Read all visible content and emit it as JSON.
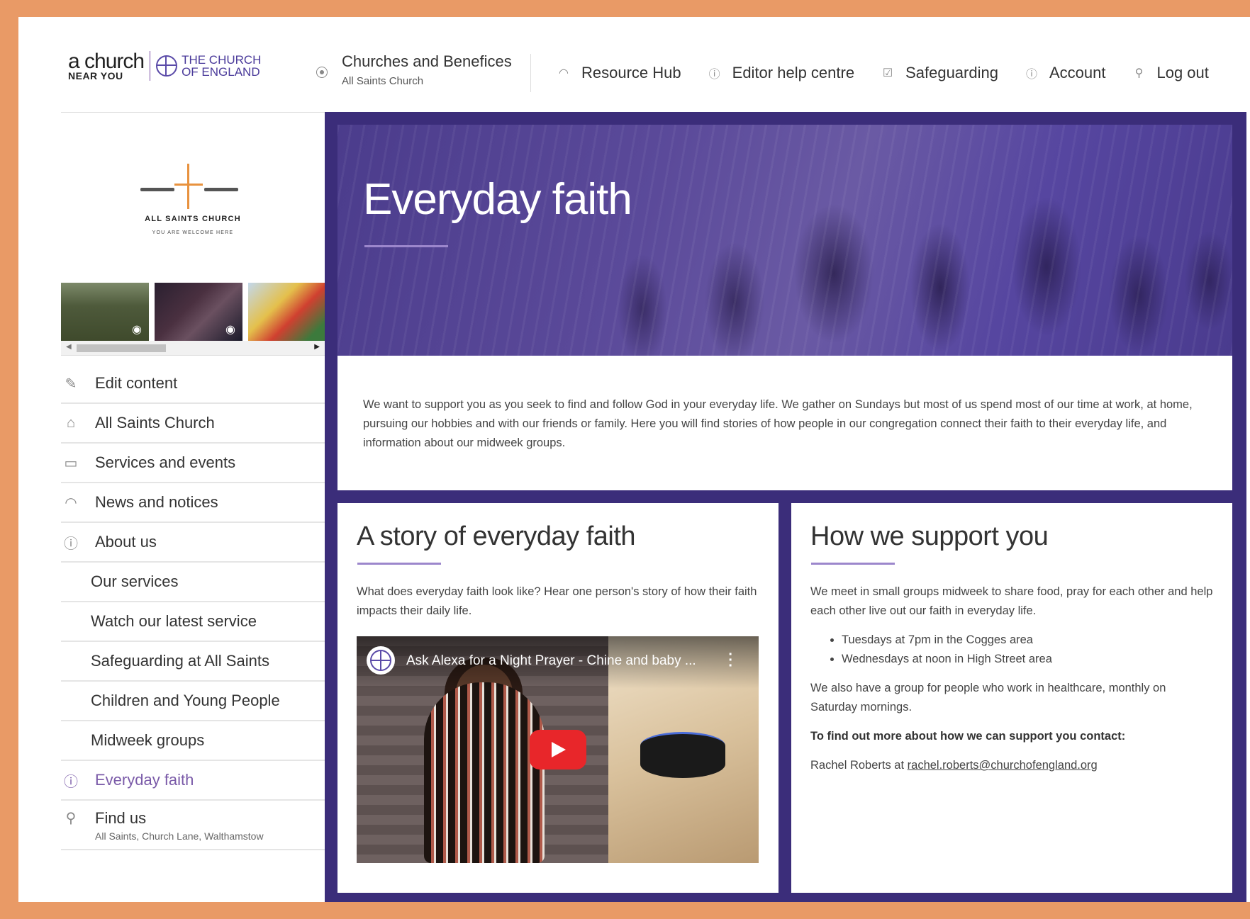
{
  "header": {
    "logo": {
      "a_church": "a church",
      "near_you": "NEAR YOU",
      "coe_line1": "THE CHURCH",
      "coe_line2": "OF ENGLAND"
    },
    "churches": {
      "title": "Churches and Benefices",
      "subtitle": "All Saints Church"
    },
    "nav": [
      {
        "label": "Resource Hub",
        "icon": "broadcast-icon"
      },
      {
        "label": "Editor help centre",
        "icon": "help-icon"
      },
      {
        "label": "Safeguarding",
        "icon": "checkbox-icon"
      },
      {
        "label": "Account",
        "icon": "info-icon"
      },
      {
        "label": "Log out",
        "icon": "key-icon"
      }
    ]
  },
  "sidebar": {
    "church_logo": {
      "name": "ALL SAINTS CHURCH",
      "tagline": "YOU ARE WELCOME HERE"
    },
    "menu": [
      {
        "label": "Edit content",
        "icon": "pencil-icon"
      },
      {
        "label": "All Saints Church",
        "icon": "home-icon"
      },
      {
        "label": "Services and events",
        "icon": "calendar-icon"
      },
      {
        "label": "News and notices",
        "icon": "broadcast-icon"
      },
      {
        "label": "About us",
        "icon": "info-icon"
      }
    ],
    "submenu": [
      {
        "label": "Our services"
      },
      {
        "label": "Watch our latest service"
      },
      {
        "label": "Safeguarding at All Saints"
      },
      {
        "label": "Children and Young People"
      },
      {
        "label": "Midweek groups"
      }
    ],
    "active": {
      "label": "Everyday faith",
      "icon": "info-icon"
    },
    "find_us": {
      "label": "Find us",
      "address": "All Saints, Church Lane, Walthamstow",
      "icon": "map-pin-icon"
    }
  },
  "main": {
    "hero_title": "Everyday faith",
    "intro": "We want to support you as you seek to find and follow God in your everyday life. We gather on Sundays but most of us spend most of our time at work, at home, pursuing our hobbies and with our friends or family. Here you will find stories of how people in our congregation connect their faith to their everyday life, and information about our midweek groups.",
    "story": {
      "title": "A story of everyday faith",
      "text": "What does everyday faith look like? Hear one person's story of how their faith impacts their daily life.",
      "video_title": "Ask Alexa for a Night Prayer - Chine and baby ..."
    },
    "support": {
      "title": "How we support you",
      "text": "We meet in small groups midweek to share food, pray for each other and help each other live out our faith in everyday life.",
      "bullets": [
        "Tuesdays at 7pm in the Cogges area",
        "Wednesdays at noon in High Street area"
      ],
      "healthcare": "We also have a group for people who work in healthcare, monthly on Saturday mornings.",
      "contact_heading": "To find out more about how we can support you contact:",
      "contact_prefix": "Rachel Roberts at ",
      "contact_email": "rachel.roberts@churchofengland.org"
    }
  },
  "colors": {
    "frame": "#e99a66",
    "main_bg": "#3b2d7a",
    "accent": "#7a5aa8",
    "underline": "#9c87cc"
  }
}
